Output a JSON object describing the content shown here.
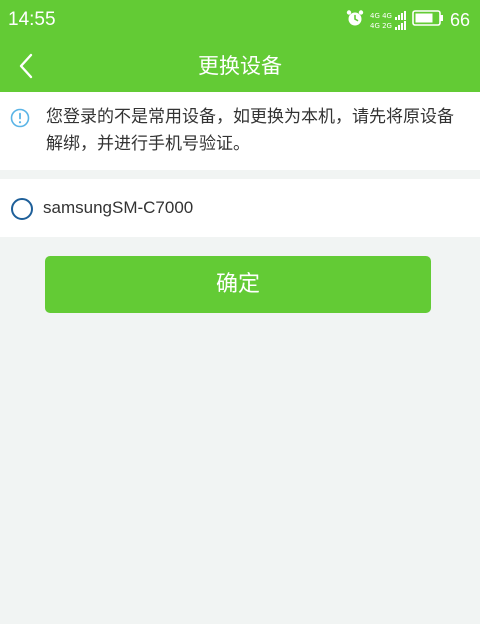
{
  "status_bar": {
    "time": "14:55",
    "network_top": "4G 4G",
    "network_bottom": "4G 2G",
    "battery_level": "66",
    "icons": [
      "alarm-icon",
      "signal-icon",
      "battery-icon"
    ]
  },
  "header": {
    "title": "更换设备",
    "back_icon": "chevron-left-icon"
  },
  "notice": {
    "icon": "info-icon",
    "text": "您登录的不是常用设备，如更换为本机，请先将原设备解绑，并进行手机号验证。"
  },
  "device_list": {
    "items": [
      {
        "label": "samsungSM-C7000",
        "selected": false
      }
    ]
  },
  "actions": {
    "confirm_label": "确定"
  },
  "colors": {
    "brand_green": "#63cb35",
    "page_background": "#f1f4f3",
    "radio_border": "#1e5f99",
    "info_icon": "#5ab4e6"
  }
}
